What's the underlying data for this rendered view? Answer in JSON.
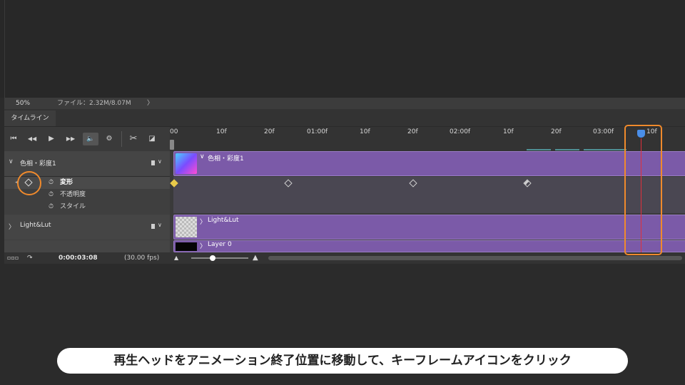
{
  "status": {
    "zoom": "50%",
    "file_info": "ファイル：2.32M/8.07M",
    "arrow": "〉"
  },
  "panel": {
    "tab_label": "タイムライン"
  },
  "controls": {
    "first": "⏮",
    "prev": "◀◀",
    "play": "▶",
    "next": "▶▶",
    "audio": "🔈",
    "settings": "⚙",
    "cut": "✂",
    "transition": "◪"
  },
  "ruler": {
    "ticks": [
      "00",
      "10f",
      "20f",
      "01:00f",
      "10f",
      "20f",
      "02:00f",
      "10f",
      "20f",
      "03:00f",
      "10f"
    ]
  },
  "layers": {
    "hue": {
      "chevron": "∨",
      "name": "色相・彩度1",
      "track_label": "色相・彩度1"
    },
    "props": [
      {
        "name": "変形"
      },
      {
        "name": "不透明度"
      },
      {
        "name": "スタイル"
      }
    ],
    "light": {
      "chevron": "〉",
      "name": "Light&Lut",
      "track_label": "Light&Lut"
    },
    "layer0": {
      "name": "Layer 0",
      "track_label": "Layer 0"
    }
  },
  "footer": {
    "timecode": "0:00:03:08",
    "fps": "(30.00 fps)"
  },
  "caption": "再生ヘッドをアニメーション終了位置に移動して、キーフレームアイコンをクリック",
  "colors": {
    "track": "#7b5aa8",
    "highlight": "#f08a2c",
    "playhead": "#e0303a"
  }
}
